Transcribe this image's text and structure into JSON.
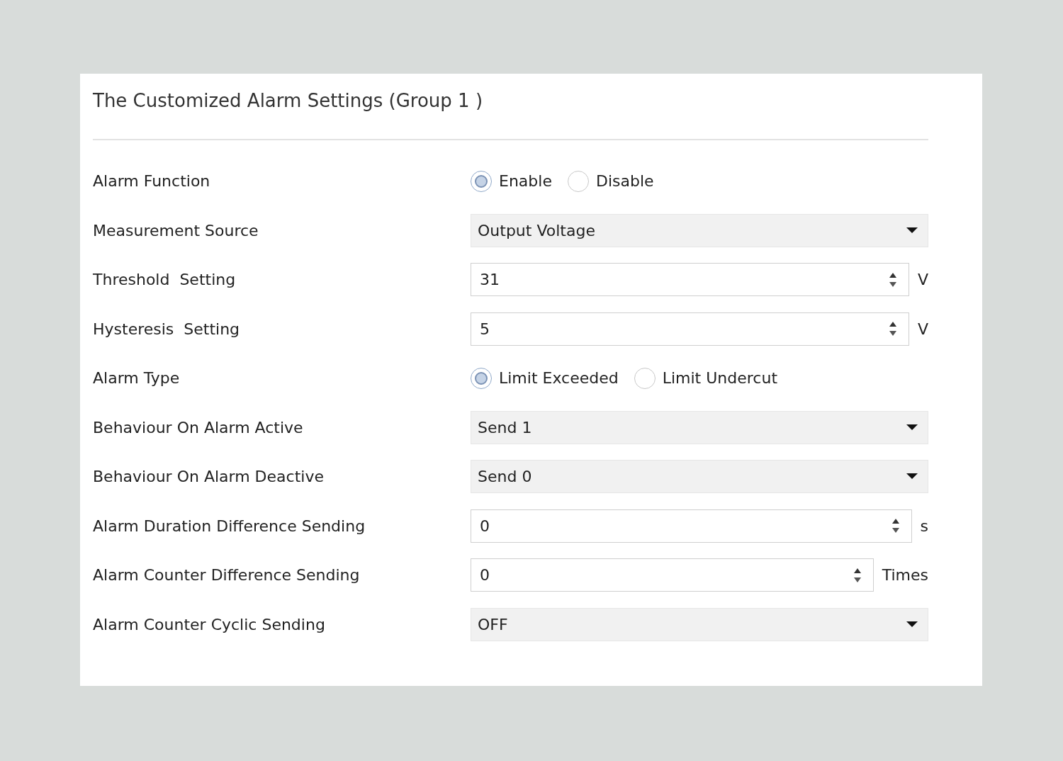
{
  "title": "The Customized Alarm Settings (Group 1 )",
  "rows": [
    {
      "label": "Alarm Function",
      "kind": "radio",
      "options": [
        {
          "label": "Enable",
          "selected": true
        },
        {
          "label": "Disable",
          "selected": false
        }
      ]
    },
    {
      "label": "Measurement Source",
      "kind": "dropdown",
      "value": "Output Voltage"
    },
    {
      "label": "Threshold  Setting",
      "kind": "spin",
      "value": "31",
      "unit": "V"
    },
    {
      "label": "Hysteresis  Setting",
      "kind": "spin",
      "value": "5",
      "unit": "V"
    },
    {
      "label": "Alarm Type",
      "kind": "radio",
      "options": [
        {
          "label": "Limit Exceeded",
          "selected": true
        },
        {
          "label": "Limit Undercut",
          "selected": false
        }
      ]
    },
    {
      "label": "Behaviour On Alarm Active",
      "kind": "dropdown",
      "value": "Send 1"
    },
    {
      "label": "Behaviour On Alarm Deactive",
      "kind": "dropdown",
      "value": "Send 0"
    },
    {
      "label": "Alarm Duration Difference Sending",
      "kind": "spin",
      "value": "0",
      "unit": "s"
    },
    {
      "label": "Alarm Counter Difference Sending",
      "kind": "spin",
      "value": "0",
      "unit": "Times"
    },
    {
      "label": "Alarm Counter Cyclic Sending",
      "kind": "dropdown",
      "value": "OFF"
    }
  ]
}
